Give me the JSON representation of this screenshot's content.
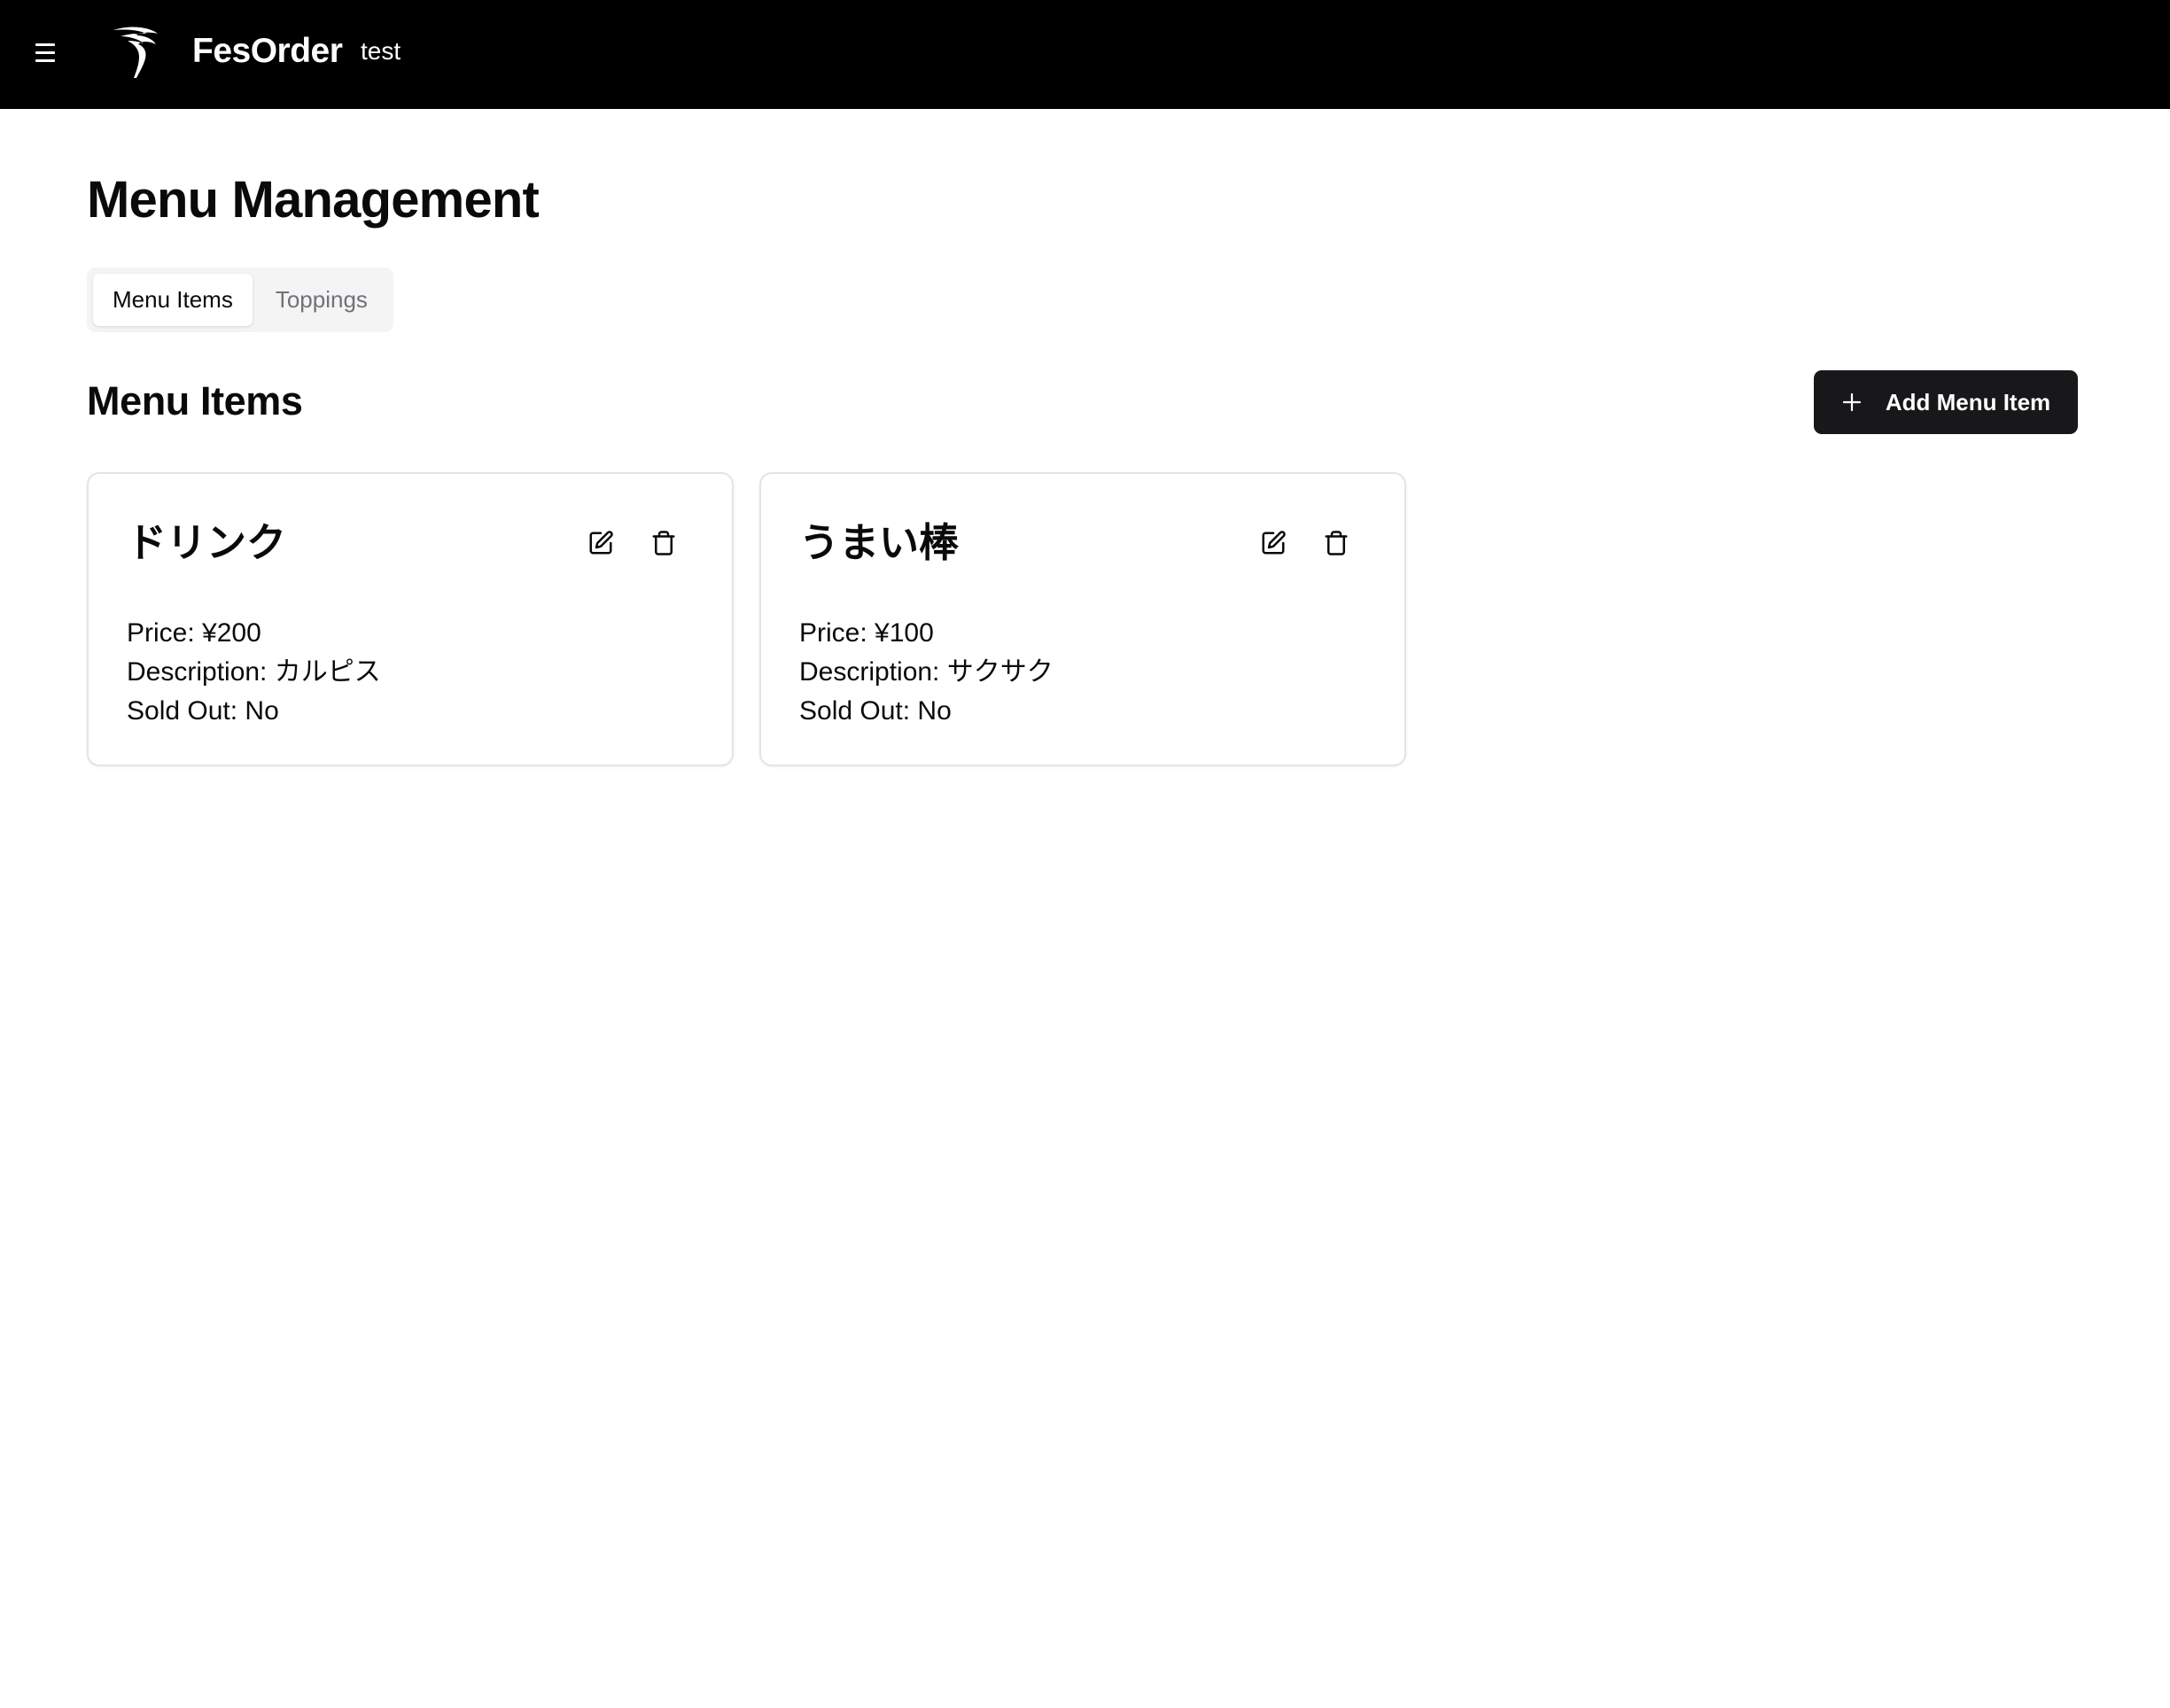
{
  "header": {
    "menu_icon": "hamburger-icon",
    "logo_icon": "swoosh-logo",
    "brand": "FesOrder",
    "org": "test"
  },
  "page": {
    "title": "Menu Management"
  },
  "tabs": [
    {
      "label": "Menu Items",
      "active": true
    },
    {
      "label": "Toppings",
      "active": false
    }
  ],
  "section": {
    "title": "Menu Items",
    "add_button_label": "Add Menu Item",
    "add_button_icon": "plus-icon"
  },
  "items": [
    {
      "name": "ドリンク",
      "price_label": "Price:",
      "price": "¥200",
      "description_label": "Description:",
      "description": "カルピス",
      "sold_out_label": "Sold Out:",
      "sold_out": "No",
      "edit_icon": "edit-icon",
      "delete_icon": "trash-icon"
    },
    {
      "name": "うまい棒",
      "price_label": "Price:",
      "price": "¥100",
      "description_label": "Description:",
      "description": "サクサク",
      "sold_out_label": "Sold Out:",
      "sold_out": "No",
      "edit_icon": "edit-icon",
      "delete_icon": "trash-icon"
    }
  ],
  "colors": {
    "topbar": "#000000",
    "primary_button": "#18181b",
    "tab_bg": "#f4f4f5",
    "card_border": "#e4e4e7"
  }
}
